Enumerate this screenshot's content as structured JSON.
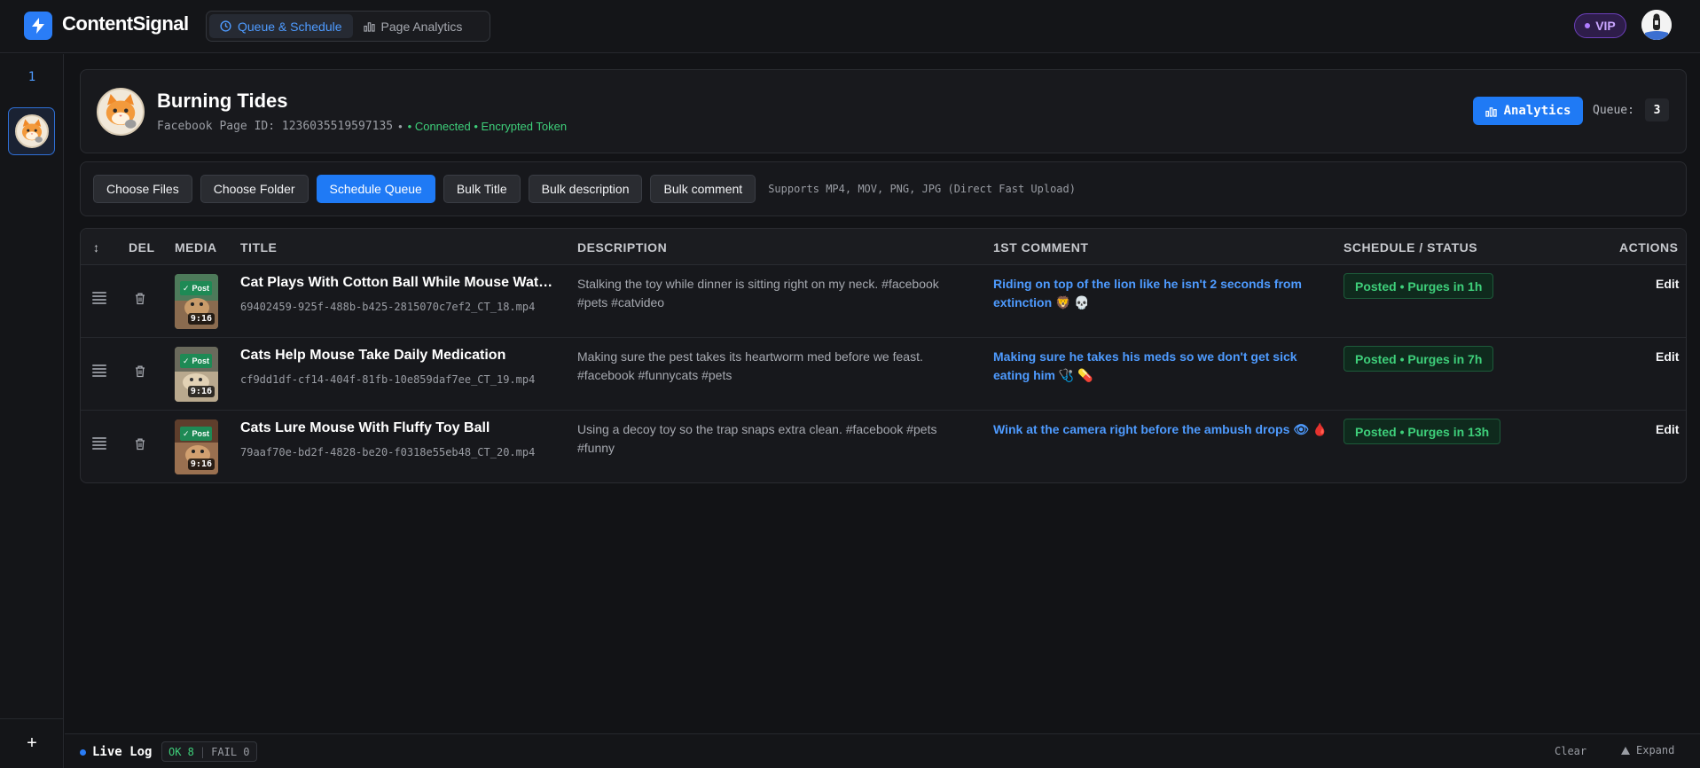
{
  "app": {
    "brand": "ContentSignal",
    "accent": "#1f7af5"
  },
  "nav": {
    "tabs": [
      {
        "label": "Queue & Schedule",
        "icon": "clock-icon",
        "active": true
      },
      {
        "label": "Page Analytics",
        "icon": "bar-chart-icon",
        "active": false
      }
    ]
  },
  "header": {
    "vip_label": "VIP"
  },
  "sidebar": {
    "page_count": "1",
    "add_label": "+"
  },
  "page": {
    "name": "Burning Tides",
    "id_text": "Facebook Page ID: 1236035519597135",
    "bullet": "•",
    "connection": "• Connected • Encrypted Token",
    "analytics_label": "Analytics",
    "queue_label": "Queue:",
    "queue_count": "3"
  },
  "toolbar": {
    "buttons": [
      {
        "label": "Choose Files",
        "primary": false
      },
      {
        "label": "Choose Folder",
        "primary": false
      },
      {
        "label": "Schedule Queue",
        "primary": true
      },
      {
        "label": "Bulk Title",
        "primary": false
      },
      {
        "label": "Bulk description",
        "primary": false
      },
      {
        "label": "Bulk comment",
        "primary": false
      }
    ],
    "hint": "Supports MP4, MOV, PNG, JPG (Direct Fast Upload)"
  },
  "table": {
    "columns": {
      "sort": "↕",
      "del": "DEL",
      "media": "MEDIA",
      "title": "TITLE",
      "description": "DESCRIPTION",
      "comment": "1ST COMMENT",
      "status": "SCHEDULE / STATUS",
      "actions": "ACTIONS"
    },
    "rows": [
      {
        "badge": "Post",
        "ratio": "9:16",
        "title": "Cat Plays With Cotton Ball While Mouse Watches",
        "file": "69402459-925f-488b-b425-2815070c7ef2_CT_18.mp4",
        "description": "Stalking the toy while dinner is sitting right on my neck. #facebook #pets #catvideo",
        "comment": "Riding on top of the lion like he isn't 2 seconds from extinction 🦁 💀",
        "status": "Posted • Purges in 1h",
        "action": "Edit"
      },
      {
        "badge": "Post",
        "ratio": "9:16",
        "title": "Cats Help Mouse Take Daily Medication",
        "file": "cf9dd1df-cf14-404f-81fb-10e859daf7ee_CT_19.mp4",
        "description": "Making sure the pest takes its heartworm med before we feast. #facebook #funnycats #pets",
        "comment": "Making sure he takes his meds so we don't get sick eating him 🩺 💊",
        "status": "Posted • Purges in 7h",
        "action": "Edit"
      },
      {
        "badge": "Post",
        "ratio": "9:16",
        "title": "Cats Lure Mouse With Fluffy Toy Ball",
        "file": "79aaf70e-bd2f-4828-be20-f0318e55eb48_CT_20.mp4",
        "description": "Using a decoy toy so the trap snaps extra clean. #facebook #pets #funny",
        "comment": "Wink at the camera right before the ambush drops 👁 🩸",
        "status": "Posted • Purges in 13h",
        "action": "Edit"
      }
    ]
  },
  "footer": {
    "live_label": "Live Log",
    "ok": "OK 8",
    "divider": "|",
    "fail": "FAIL 0",
    "clear": "Clear",
    "expand": "Expand"
  }
}
